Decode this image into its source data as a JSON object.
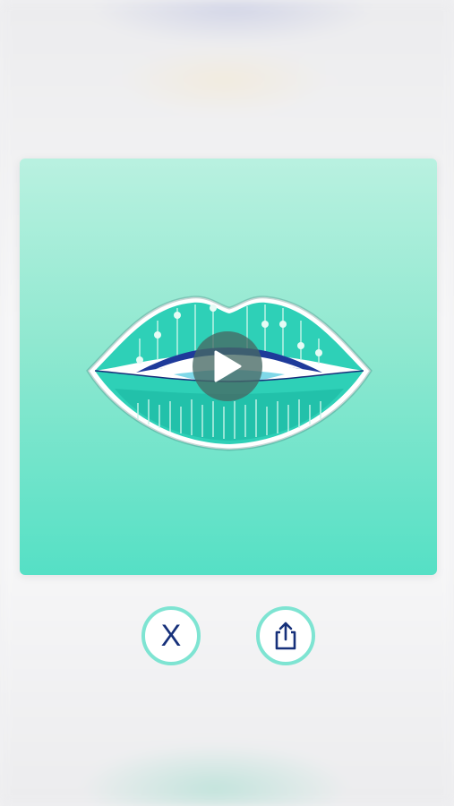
{
  "background": {
    "page_color": "#f1f1f3"
  },
  "preview": {
    "gradient_top": "#b9f1e0",
    "gradient_bottom": "#55e0c5",
    "artwork": "lips-illustration",
    "play_icon": "play-icon"
  },
  "controls": {
    "close_label": "X",
    "close_icon": "close-icon",
    "share_icon": "share-icon",
    "ring_color": "#7ee4d2",
    "icon_color": "#16307a"
  }
}
